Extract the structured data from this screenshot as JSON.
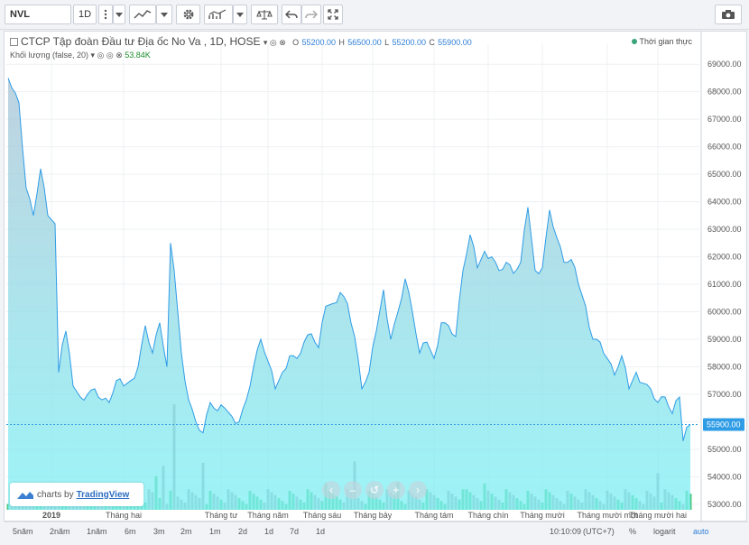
{
  "toolbar": {
    "symbol": "NVL",
    "interval": "1D",
    "icons": [
      "chart-style-icon",
      "settings-icon",
      "indicators-icon",
      "compare-icon",
      "undo-icon",
      "redo-icon",
      "fullscreen-icon",
      "camera-icon"
    ]
  },
  "legend": {
    "title": "CTCP Tập đoàn Đầu tư Địa ốc No Va , 1D, HOSE",
    "o_label": "O",
    "o": "55200.00",
    "h_label": "H",
    "h": "56500.00",
    "l_label": "L",
    "l": "55200.00",
    "c_label": "C",
    "c": "55900.00",
    "volume_label": "Khối lượng (false, 20)",
    "volume_value": "53.84K",
    "realtime": "Thời gian thực"
  },
  "colors": {
    "line": "#2f9ce6",
    "area_top": "#a9c4d6",
    "area_bottom": "#7cf0f4",
    "vol_up": "#2fbf6f",
    "vol_down": "#9a9ea3",
    "price_tag": "#2f9ce6"
  },
  "branding": {
    "prefix": "charts by",
    "name": "TradingView"
  },
  "bottom": {
    "ranges": [
      "5năm",
      "2năm",
      "1năm",
      "6m",
      "3m",
      "2m",
      "1m",
      "2d",
      "1d",
      "7d",
      "1d"
    ],
    "time": "10:10:09",
    "tz": "(UTC+7)",
    "pct": "%",
    "log": "logarit",
    "auto": "auto"
  },
  "chart_data": {
    "type": "area",
    "symbol": "NVL",
    "exchange": "HOSE",
    "interval": "1D",
    "last_price": 55900,
    "last_price_label": "55900.00",
    "ylim": [
      52800,
      69400
    ],
    "y_ticks": [
      53000,
      54000,
      55000,
      56000,
      57000,
      58000,
      59000,
      60000,
      61000,
      62000,
      63000,
      64000,
      65000,
      66000,
      67000,
      68000,
      69000
    ],
    "y_tick_labels": [
      "53000.00",
      "54000.00",
      "55000.00",
      "56000.00",
      "57000.00",
      "58000.00",
      "59000.00",
      "60000.00",
      "61000.00",
      "62000.00",
      "63000.00",
      "64000.00",
      "65000.00",
      "66000.00",
      "67000.00",
      "68000.00",
      "69000.00"
    ],
    "x_labels": [
      "2019",
      "Tháng hai",
      "Tháng tư",
      "Tháng năm",
      "Tháng sáu",
      "Tháng bảy",
      "Tháng tám",
      "Tháng chín",
      "Tháng mười",
      "Tháng mười một",
      "Tháng mười hai"
    ],
    "x_label_index": [
      12,
      32,
      59,
      72,
      87,
      101,
      118,
      133,
      148,
      166,
      180
    ],
    "n_points": 190,
    "price_keys": [
      [
        0,
        68500
      ],
      [
        3,
        67600
      ],
      [
        5,
        64500
      ],
      [
        7,
        63500
      ],
      [
        9,
        65200
      ],
      [
        11,
        63500
      ],
      [
        13,
        63200
      ],
      [
        14,
        57800
      ],
      [
        15,
        58800
      ],
      [
        16,
        59300
      ],
      [
        18,
        57300
      ],
      [
        20,
        56900
      ],
      [
        22,
        57000
      ],
      [
        24,
        57200
      ],
      [
        26,
        56800
      ],
      [
        28,
        56700
      ],
      [
        30,
        57500
      ],
      [
        32,
        57300
      ],
      [
        34,
        57500
      ],
      [
        36,
        58000
      ],
      [
        38,
        59500
      ],
      [
        40,
        58500
      ],
      [
        42,
        59600
      ],
      [
        44,
        58000
      ],
      [
        45,
        62500
      ],
      [
        46,
        61500
      ],
      [
        48,
        58500
      ],
      [
        50,
        56800
      ],
      [
        52,
        56000
      ],
      [
        54,
        55600
      ],
      [
        56,
        56700
      ],
      [
        58,
        56400
      ],
      [
        60,
        56500
      ],
      [
        62,
        56200
      ],
      [
        64,
        56000
      ],
      [
        66,
        56800
      ],
      [
        68,
        58000
      ],
      [
        70,
        59000
      ],
      [
        72,
        58200
      ],
      [
        74,
        57200
      ],
      [
        76,
        57800
      ],
      [
        78,
        58400
      ],
      [
        80,
        58300
      ],
      [
        82,
        58900
      ],
      [
        84,
        59200
      ],
      [
        86,
        58700
      ],
      [
        88,
        60200
      ],
      [
        90,
        60300
      ],
      [
        92,
        60700
      ],
      [
        94,
        60300
      ],
      [
        96,
        59100
      ],
      [
        98,
        57200
      ],
      [
        100,
        57800
      ],
      [
        102,
        59300
      ],
      [
        104,
        60800
      ],
      [
        106,
        59000
      ],
      [
        108,
        60000
      ],
      [
        110,
        61200
      ],
      [
        112,
        60000
      ],
      [
        114,
        58500
      ],
      [
        116,
        58900
      ],
      [
        118,
        58300
      ],
      [
        120,
        59600
      ],
      [
        122,
        59500
      ],
      [
        124,
        59100
      ],
      [
        126,
        61500
      ],
      [
        128,
        62800
      ],
      [
        130,
        61600
      ],
      [
        132,
        62200
      ],
      [
        134,
        62000
      ],
      [
        136,
        61500
      ],
      [
        138,
        61800
      ],
      [
        140,
        61400
      ],
      [
        142,
        61800
      ],
      [
        144,
        63800
      ],
      [
        146,
        61500
      ],
      [
        148,
        61600
      ],
      [
        150,
        63700
      ],
      [
        152,
        62700
      ],
      [
        154,
        61800
      ],
      [
        156,
        61900
      ],
      [
        158,
        61000
      ],
      [
        160,
        60200
      ],
      [
        162,
        59000
      ],
      [
        164,
        58900
      ],
      [
        166,
        58300
      ],
      [
        168,
        57700
      ],
      [
        170,
        58400
      ],
      [
        172,
        57200
      ],
      [
        174,
        57800
      ],
      [
        176,
        57400
      ],
      [
        178,
        57200
      ],
      [
        180,
        56700
      ],
      [
        182,
        56900
      ],
      [
        184,
        56300
      ],
      [
        186,
        56900
      ],
      [
        187,
        55300
      ],
      [
        188,
        55800
      ],
      [
        189,
        55900
      ]
    ],
    "volume_key_bars": [
      [
        5,
        16
      ],
      [
        6,
        12
      ],
      [
        31,
        11
      ],
      [
        34,
        14
      ],
      [
        41,
        23
      ],
      [
        43,
        30
      ],
      [
        46,
        72
      ],
      [
        54,
        32
      ],
      [
        88,
        18
      ],
      [
        96,
        33
      ],
      [
        108,
        19
      ],
      [
        126,
        14
      ],
      [
        132,
        18
      ],
      [
        180,
        25
      ]
    ]
  }
}
